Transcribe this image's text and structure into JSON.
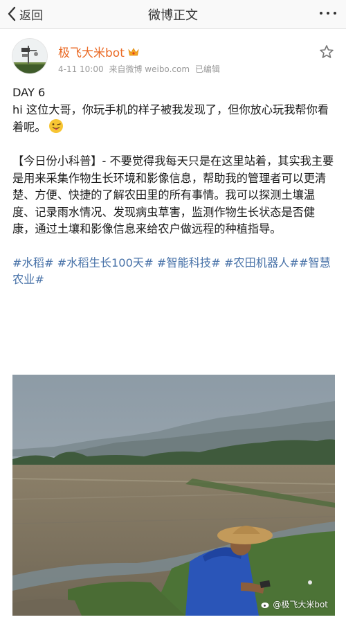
{
  "nav": {
    "back_label": "返回",
    "title": "微博正文"
  },
  "post": {
    "author": "极飞大米bot",
    "date": "4-11 10:00",
    "source": "来自微博 weibo.com",
    "edited": "已编辑",
    "text": {
      "line_day": "DAY 6",
      "para1": "hi 这位大哥，你玩手机的样子被我发现了，但你放心玩我帮你看着呢。",
      "para2": "【今日份小科普】- 不要觉得我每天只是在这里站着，其实我主要是用来采集作物生长环境和影像信息，帮助我的管理者可以更清楚、方便、快捷的了解农田里的所有事情。我可以探测土壤温度、记录雨水情况、发现病虫草害，监测作物生长状态是否健康，通过土壤和影像信息来给农户做远程的种植指导。"
    },
    "tags": [
      "#水稻#",
      "#水稻生长100天#",
      "#智能科技#",
      "#农田机器人#",
      "#智慧农业#"
    ],
    "image": {
      "watermark": "@极飞大米bot"
    }
  },
  "colors": {
    "accent_name": "#ea6a25",
    "link": "#4872a8",
    "meta": "#9a9a9a"
  },
  "icons": {
    "back": "chevron-left-icon",
    "more": "more-dots-icon",
    "crown": "crown-icon",
    "favorite": "star-outline-icon",
    "emoji": "tongue-face-emoji-icon"
  }
}
